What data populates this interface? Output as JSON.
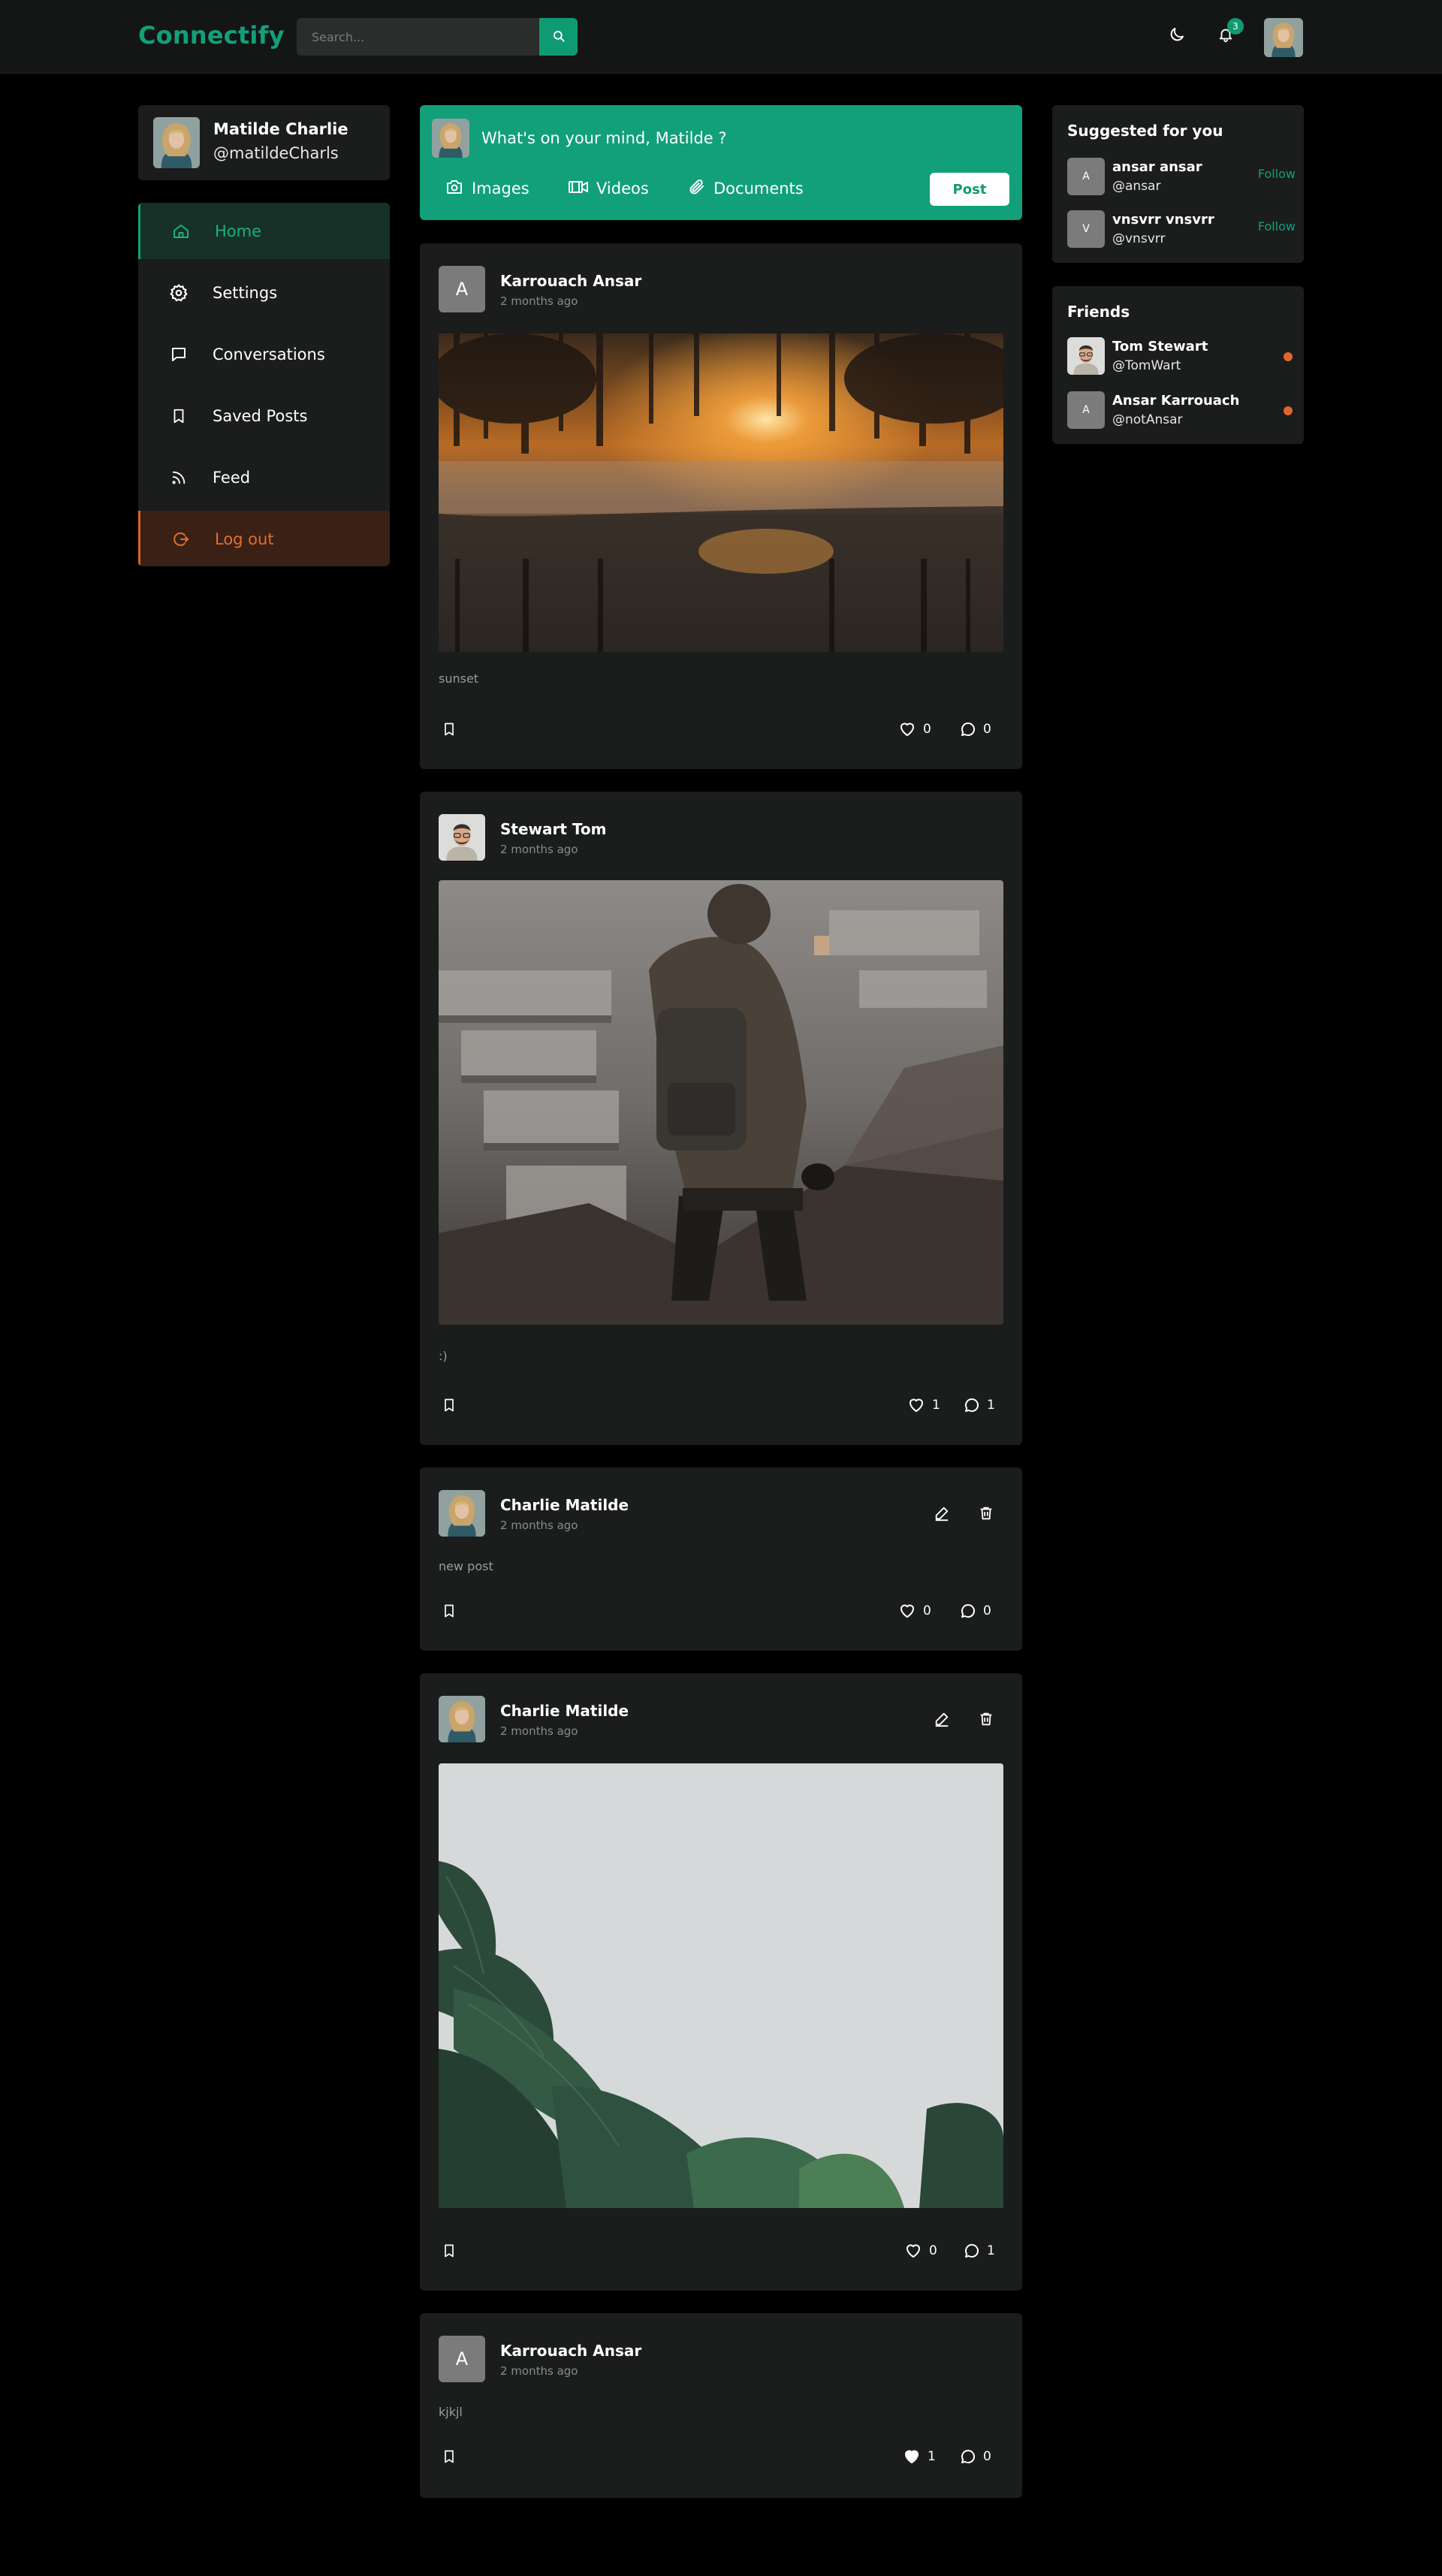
{
  "app": {
    "name": "Connectify"
  },
  "header": {
    "search_placeholder": "Search...",
    "notification_count": "3",
    "icons": {
      "search": "search-icon",
      "theme": "moon-icon",
      "notifications": "bell-icon"
    }
  },
  "profile": {
    "name": "Matilde Charlie",
    "handle": "@matildeCharls"
  },
  "nav": {
    "items": [
      {
        "label": "Home",
        "icon": "home-icon",
        "active": true
      },
      {
        "label": "Settings",
        "icon": "gear-icon"
      },
      {
        "label": "Conversations",
        "icon": "chat-bubble-icon"
      },
      {
        "label": "Saved Posts",
        "icon": "bookmark-icon"
      },
      {
        "label": "Feed",
        "icon": "rss-icon"
      },
      {
        "label": "Log out",
        "icon": "logout-icon"
      }
    ]
  },
  "composer": {
    "prompt": "What's on your mind, Matilde ?",
    "options": [
      {
        "label": "Images",
        "icon": "camera-icon"
      },
      {
        "label": "Videos",
        "icon": "video-icon"
      },
      {
        "label": "Documents",
        "icon": "paperclip-icon"
      }
    ],
    "post_label": "Post"
  },
  "posts": [
    {
      "author": "Karrouach Ansar",
      "initial": "A",
      "time": "2 months ago",
      "image": "sunset lake photo",
      "text": "sunset",
      "likes": "0",
      "comments": "0",
      "liked": false,
      "own": false
    },
    {
      "author": "Stewart Tom",
      "initial": "",
      "time": "2 months ago",
      "image": "hiker with backpack photo",
      "text": ":)",
      "likes": "1",
      "comments": "1",
      "liked": false,
      "own": false
    },
    {
      "author": "Charlie Matilde",
      "initial": "",
      "time": "2 months ago",
      "image": "",
      "text": "new post",
      "likes": "0",
      "comments": "0",
      "liked": false,
      "own": true
    },
    {
      "author": "Charlie Matilde",
      "initial": "",
      "time": "2 months ago",
      "image": "monstera plant photo",
      "text": "",
      "likes": "0",
      "comments": "1",
      "liked": false,
      "own": true
    },
    {
      "author": "Karrouach Ansar",
      "initial": "A",
      "time": "2 months ago",
      "image": "",
      "text": "kjkjl",
      "likes": "1",
      "comments": "0",
      "liked": true,
      "own": false
    }
  ],
  "suggested": {
    "title": "Suggested for you",
    "users": [
      {
        "initial": "A",
        "name": "ansar ansar",
        "handle": "@ansar",
        "action": "Follow"
      },
      {
        "initial": "V",
        "name": "vnsvrr vnsvrr",
        "handle": "@vnsvrr",
        "action": "Follow"
      }
    ]
  },
  "friends": {
    "title": "Friends",
    "users": [
      {
        "initial": "",
        "name": "Tom Stewart",
        "handle": "@TomWart",
        "status_color": "#e0652c"
      },
      {
        "initial": "A",
        "name": "Ansar Karrouach",
        "handle": "@notAnsar",
        "status_color": "#e0652c"
      }
    ]
  },
  "colors": {
    "accent": "#11a07a",
    "background": "#000000",
    "card": "#1b1c1c",
    "logout": "#e0702e"
  }
}
